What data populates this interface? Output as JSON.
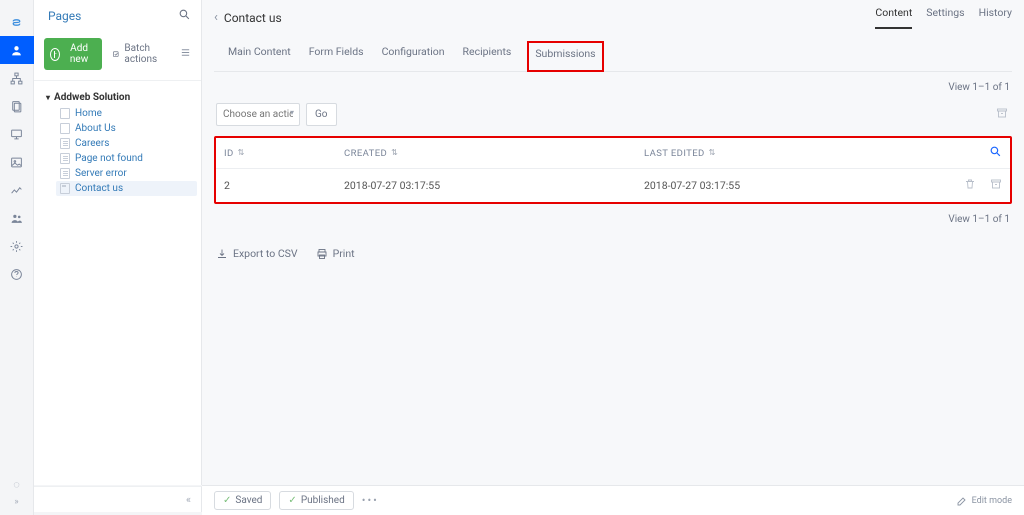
{
  "sidebar": {
    "title": "Pages",
    "add_label": "Add new",
    "batch_label": "Batch actions",
    "tree_root": "Addweb Solution",
    "items": [
      {
        "label": "Home"
      },
      {
        "label": "About Us"
      },
      {
        "label": "Careers"
      },
      {
        "label": "Page not found"
      },
      {
        "label": "Server error"
      },
      {
        "label": "Contact us"
      }
    ]
  },
  "header": {
    "title": "Contact us",
    "modes": [
      "Content",
      "Settings",
      "History"
    ],
    "tabs": [
      "Main Content",
      "Form Fields",
      "Configuration",
      "Recipients",
      "Submissions"
    ]
  },
  "pager": {
    "top": "View 1–1 of 1",
    "bottom": "View 1–1 of 1"
  },
  "actions": {
    "placeholder": "Choose an action...",
    "go": "Go"
  },
  "grid": {
    "cols": [
      "ID",
      "CREATED",
      "LAST EDITED"
    ],
    "rows": [
      {
        "id": "2",
        "created": "2018-07-27 03:17:55",
        "edited": "2018-07-27 03:17:55"
      }
    ]
  },
  "exports": {
    "csv": "Export to CSV",
    "print": "Print"
  },
  "footer": {
    "saved": "Saved",
    "published": "Published",
    "edit": "Edit mode"
  }
}
